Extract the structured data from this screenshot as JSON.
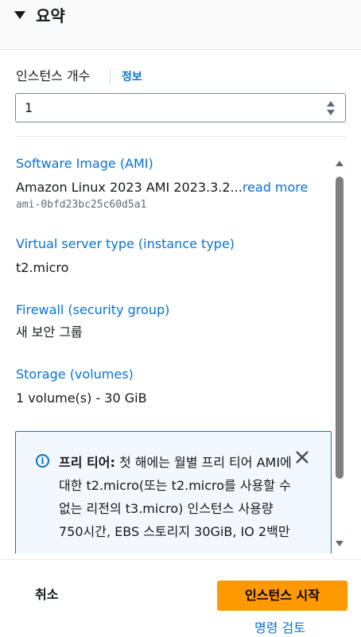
{
  "summary": {
    "title": "요약"
  },
  "instance_count": {
    "label": "인스턴스 개수",
    "info_link": "정보",
    "value": "1"
  },
  "sections": {
    "ami": {
      "label": "Software Image (AMI)",
      "value": "Amazon Linux 2023 AMI 2023.3.2...",
      "read_more": "read more",
      "id": "ami-0bfd23bc25c60d5a1"
    },
    "instance_type": {
      "label": "Virtual server type (instance type)",
      "value": "t2.micro"
    },
    "firewall": {
      "label": "Firewall (security group)",
      "value": "새 보안 그룹"
    },
    "storage": {
      "label": "Storage (volumes)",
      "value": "1 volume(s) - 30 GiB"
    }
  },
  "free_tier": {
    "title": "프리 티어:",
    "text": "첫 해에는 월별 프리 티어 AMI에 대한 t2.micro(또는 t2.micro를 사용할 수 없는 리전의 t3.micro) 인스턴스 사용량 750시간, EBS 스토리지 30GiB, IO 2백만"
  },
  "footer": {
    "cancel_label": "취소",
    "launch_label": "인스턴스 시작",
    "review_label": "명령 검토"
  },
  "colors": {
    "accent": "#0972d3",
    "primary_button": "#ff9900",
    "info_background": "#f2f8fd"
  },
  "icons": {
    "caret": "caret-down-icon",
    "info": "info-icon",
    "close": "close-icon"
  }
}
